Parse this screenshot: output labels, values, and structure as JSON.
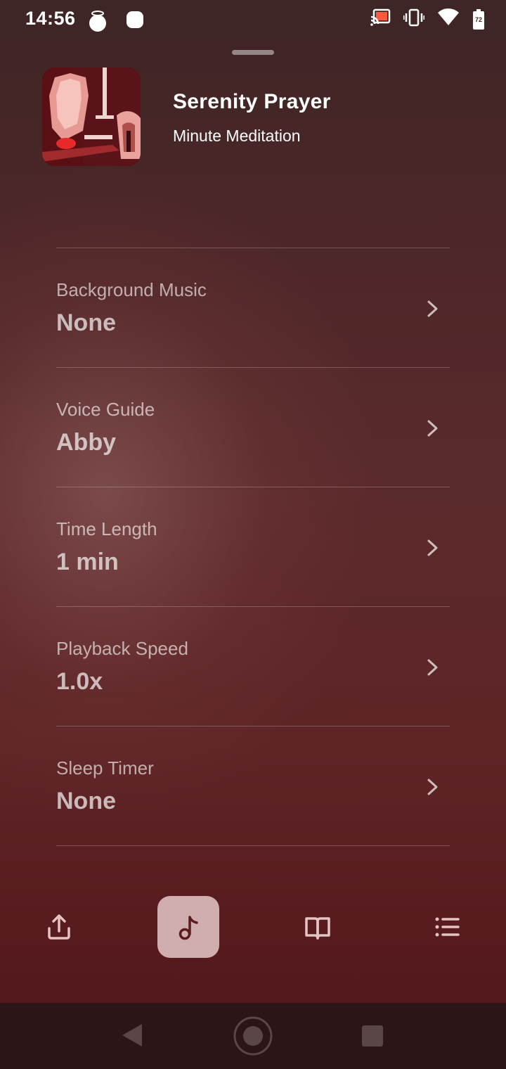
{
  "status_bar": {
    "time": "14:56",
    "left_icons": [
      "halo-notification-icon",
      "app-notification-icon"
    ],
    "right_icons": [
      "cast-icon",
      "vibrate-icon",
      "wifi-icon",
      "battery-icon"
    ],
    "battery_level": "72"
  },
  "player": {
    "title": "Serenity Prayer",
    "subtitle": "Minute Meditation"
  },
  "settings": [
    {
      "label": "Background Music",
      "value": "None"
    },
    {
      "label": "Voice Guide",
      "value": "Abby"
    },
    {
      "label": "Time Length",
      "value": "1 min"
    },
    {
      "label": "Playback Speed",
      "value": "1.0x"
    },
    {
      "label": "Sleep Timer",
      "value": "None"
    }
  ],
  "toolbar": {
    "items": [
      "share-icon",
      "music-note-icon",
      "book-icon",
      "list-icon"
    ],
    "active": "music-note-icon"
  },
  "colors": {
    "background_top": "#3e2526",
    "background_bottom": "#4c1518",
    "active_tool_bg": "#e8c7c7",
    "nav_bar": "#2c1517"
  }
}
